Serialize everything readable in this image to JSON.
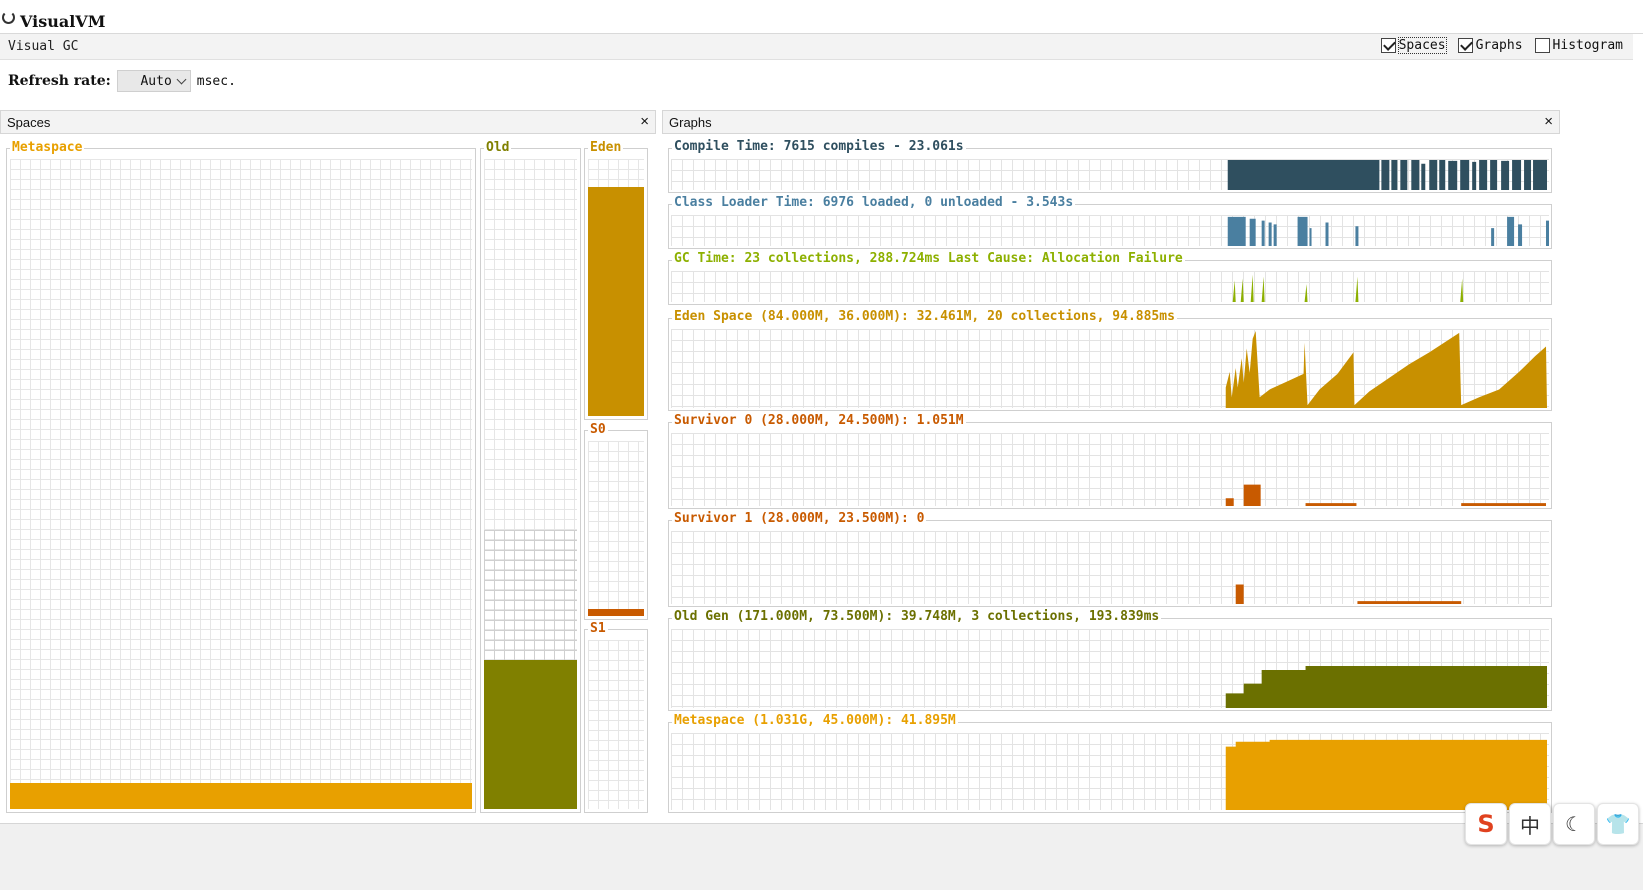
{
  "app": {
    "title": "VisualVM",
    "tab_title": "Visual GC"
  },
  "view_toggles": [
    {
      "label": "Spaces",
      "checked": true
    },
    {
      "label": "Graphs",
      "checked": true
    },
    {
      "label": "Histogram",
      "checked": false
    }
  ],
  "refresh": {
    "label": "Refresh rate:",
    "value": "Auto",
    "unit": "msec."
  },
  "panels": {
    "spaces": {
      "title": "Spaces",
      "close": "×"
    },
    "graphs": {
      "title": "Graphs",
      "close": "×"
    }
  },
  "spaces": {
    "metaspace": {
      "label": "Metaspace",
      "color": "#E8A000",
      "fill_fraction": 0.04
    },
    "old": {
      "label": "Old",
      "color": "#808000",
      "fill_fraction": 0.23,
      "committed_fraction": 0.43
    },
    "eden": {
      "label": "Eden",
      "color": "#C89000",
      "fill_fraction": 0.89
    },
    "s0": {
      "label": "S0",
      "color": "#C85A00",
      "fill_fraction": 0.04
    },
    "s1": {
      "label": "S1",
      "color": "#C85A00",
      "fill_fraction": 0.0
    }
  },
  "graphs": [
    {
      "id": "compile",
      "label": "Compile Time: 7615 compiles - 23.061s",
      "color": "#2F4F5F"
    },
    {
      "id": "classloader",
      "label": "Class Loader Time: 6976 loaded, 0 unloaded - 3.543s",
      "color": "#4A7FA0"
    },
    {
      "id": "gc",
      "label": "GC Time: 23 collections, 288.724ms Last Cause: Allocation Failure",
      "color": "#8DB000"
    },
    {
      "id": "eden",
      "label": "Eden Space (84.000M, 36.000M): 32.461M, 20 collections, 94.885ms",
      "color": "#C89000"
    },
    {
      "id": "survivor0",
      "label": "Survivor 0 (28.000M, 24.500M): 1.051M",
      "color": "#C85A00"
    },
    {
      "id": "survivor1",
      "label": "Survivor 1 (28.000M, 23.500M): 0",
      "color": "#C85A00"
    },
    {
      "id": "oldgen",
      "label": "Old Gen (171.000M, 73.500M): 39.748M, 3 collections, 193.839ms",
      "color": "#6B7000"
    },
    {
      "id": "metaspace",
      "label": "Metaspace (1.031G, 45.000M): 41.895M",
      "color": "#E8A000"
    }
  ],
  "tray": [
    {
      "name": "ime-s-icon",
      "glyph": "S"
    },
    {
      "name": "language-zh",
      "glyph": "中"
    },
    {
      "name": "moon-icon",
      "glyph": "☾"
    },
    {
      "name": "skin-shirt-icon",
      "glyph": "👕"
    }
  ]
}
